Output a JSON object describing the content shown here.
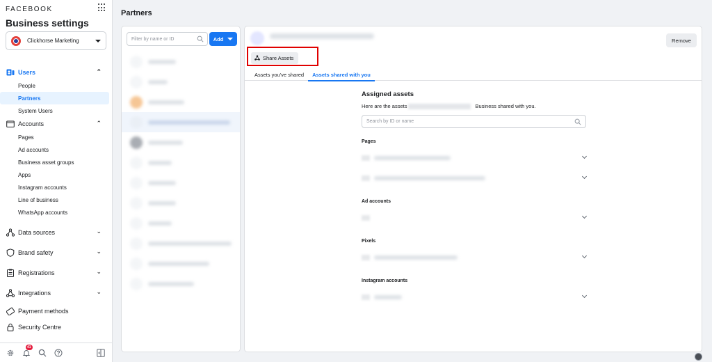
{
  "app": {
    "brand": "FACEBOOK",
    "heading": "Business settings",
    "business_name": "Clickhorse Marketing"
  },
  "sidebar": {
    "sections": [
      {
        "id": "users",
        "label": "Users",
        "icon": "users-icon",
        "expanded": true,
        "active": true,
        "items": [
          {
            "label": "People",
            "active": false
          },
          {
            "label": "Partners",
            "active": true
          },
          {
            "label": "System Users",
            "active": false
          }
        ]
      },
      {
        "id": "accounts",
        "label": "Accounts",
        "icon": "accounts-icon",
        "expanded": true,
        "active": false,
        "items": [
          {
            "label": "Pages"
          },
          {
            "label": "Ad accounts"
          },
          {
            "label": "Business asset groups"
          },
          {
            "label": "Apps"
          },
          {
            "label": "Instagram accounts"
          },
          {
            "label": "Line of business"
          },
          {
            "label": "WhatsApp accounts"
          }
        ]
      },
      {
        "id": "data-sources",
        "label": "Data sources",
        "icon": "data-sources-icon",
        "expanded": false
      },
      {
        "id": "brand-safety",
        "label": "Brand safety",
        "icon": "shield-icon",
        "expanded": false
      },
      {
        "id": "registrations",
        "label": "Registrations",
        "icon": "clipboard-icon",
        "expanded": false
      },
      {
        "id": "integrations",
        "label": "Integrations",
        "icon": "integrations-icon",
        "expanded": false
      },
      {
        "id": "payment-methods",
        "label": "Payment methods",
        "icon": "credit-card-icon",
        "expanded": null
      },
      {
        "id": "security-centre",
        "label": "Security Centre",
        "icon": "lock-icon",
        "expanded": null
      }
    ],
    "footer": {
      "notification_count": "41"
    }
  },
  "main": {
    "title": "Partners"
  },
  "partner_list": {
    "filter_placeholder": "Filter by name or ID",
    "add_label": "Add"
  },
  "detail": {
    "share_label": "Share Assets",
    "remove_label": "Remove",
    "tabs": [
      {
        "label": "Assets you've shared",
        "active": false
      },
      {
        "label": "Assets shared with you",
        "active": true
      }
    ],
    "assigned": {
      "title": "Assigned assets",
      "desc_prefix": "Here are the assets",
      "desc_suffix": "Business shared with you.",
      "search_placeholder": "Search by ID or name",
      "categories": [
        {
          "label": "Pages",
          "rows": 2
        },
        {
          "label": "Ad accounts",
          "rows": 1
        },
        {
          "label": "Pixels",
          "rows": 1
        },
        {
          "label": "Instagram accounts",
          "rows": 1
        }
      ]
    }
  },
  "colors": {
    "accent": "#1877f2",
    "highlight": "#e00000",
    "badge": "#e41e3f"
  }
}
